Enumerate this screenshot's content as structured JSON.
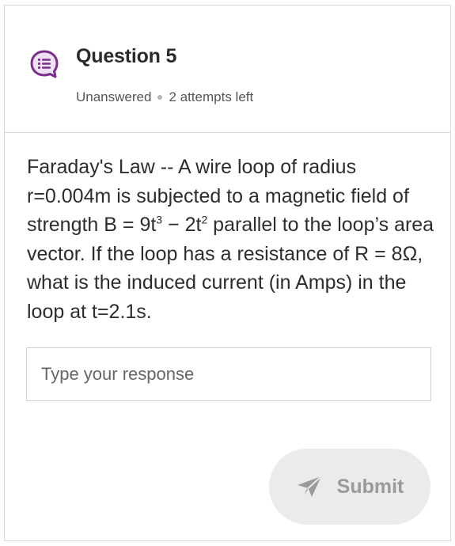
{
  "question": {
    "title": "Question 5",
    "status": "Unanswered",
    "attempts": "2 attempts left",
    "text": {
      "part1": "Faraday's Law -- A wire loop of radius r=0.004m is subjected to a magnetic field of strength B = 9t",
      "exp1": "3",
      "part2": " − 2t",
      "exp2": "2",
      "part3": " parallel to the loop’s area vector. If the loop has a resistance of R = 8Ω, what is the induced current (in Amps) in the loop at t=2.1s."
    }
  },
  "response": {
    "placeholder": "Type your response",
    "value": ""
  },
  "submit": {
    "label": "Submit"
  },
  "colors": {
    "icon_accent": "#7b2f8a",
    "icon_fill": "#efe3f3",
    "submit_bg": "#ecebea",
    "submit_text": "#9a9a9a"
  },
  "icons": {
    "question_icon": "list-chat-bubble-icon",
    "submit_icon": "paper-plane-icon"
  }
}
